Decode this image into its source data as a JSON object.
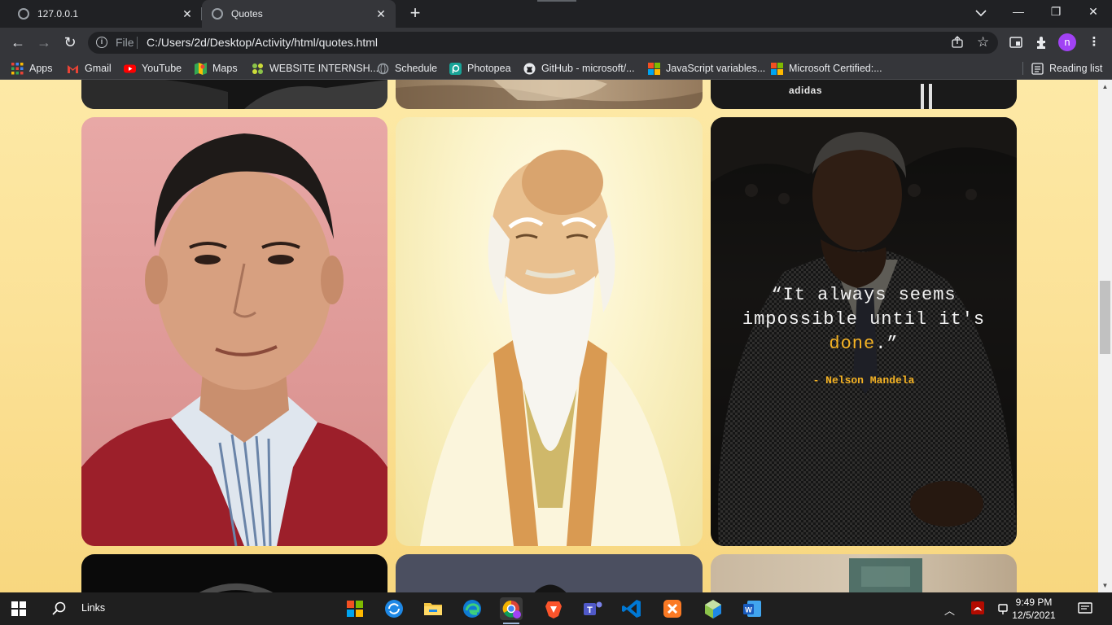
{
  "browser": {
    "tabs": [
      {
        "title": "127.0.0.1",
        "active": false
      },
      {
        "title": "Quotes",
        "active": true
      }
    ],
    "file_label": "File",
    "url": "C:/Users/2d/Desktop/Activity/html/quotes.html",
    "profile_initial": "n"
  },
  "bookmarks": [
    {
      "label": "Apps",
      "icon": "apps-grid-icon"
    },
    {
      "label": "Gmail",
      "icon": "gmail-icon"
    },
    {
      "label": "YouTube",
      "icon": "youtube-icon"
    },
    {
      "label": "Maps",
      "icon": "maps-icon"
    },
    {
      "label": "WEBSITE INTERNSH...",
      "icon": "website-icon"
    },
    {
      "label": "Schedule",
      "icon": "globe-icon"
    },
    {
      "label": "Photopea",
      "icon": "photopea-icon"
    },
    {
      "label": "GitHub - microsoft/...",
      "icon": "github-icon"
    },
    {
      "label": "JavaScript variables...",
      "icon": "microsoft-icon"
    },
    {
      "label": "Microsoft Certified:...",
      "icon": "microsoft-icon"
    }
  ],
  "reading_list_label": "Reading list",
  "page": {
    "background_colors": [
      "#fde9a6",
      "#f8d77f"
    ],
    "highlight_color": "#f5b324",
    "quote": {
      "before": "“It always seems impossible until it's ",
      "highlight": "done",
      "after": ".”",
      "author": "- Nelson Mandela"
    },
    "top_card_text": "adidas"
  },
  "taskbar": {
    "search_label": "Links",
    "time": "9:49 PM",
    "date": "12/5/2021"
  }
}
